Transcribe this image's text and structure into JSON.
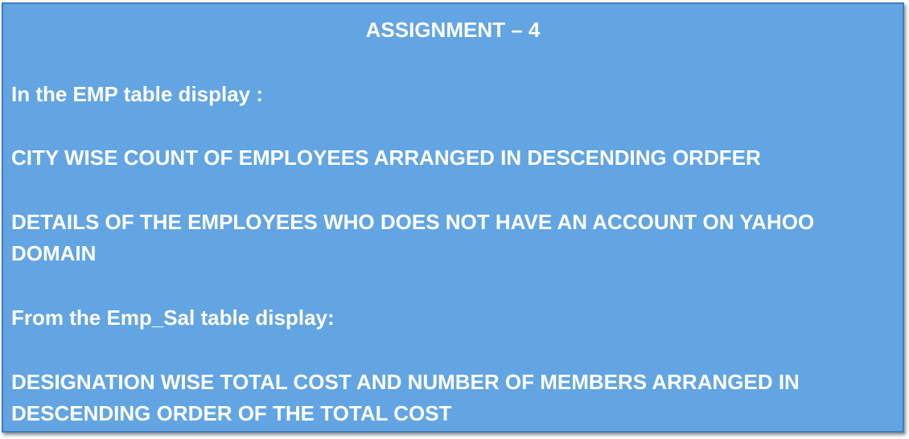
{
  "slide": {
    "title": "ASSIGNMENT – 4",
    "emp_heading": "In the EMP table display  :",
    "task_city": "CITY WISE COUNT OF EMPLOYEES ARRANGED IN DESCENDING ORDFER",
    "task_yahoo": "DETAILS OF THE EMPLOYEES WHO DOES NOT HAVE AN ACCOUNT ON YAHOO DOMAIN",
    "empsal_heading": "From the Emp_Sal table display:",
    "task_designation": "DESIGNATION WISE TOTAL COST AND NUMBER OF MEMBERS ARRANGED IN DESCENDING ORDER OF THE TOTAL COST"
  },
  "colors": {
    "box_fill": "#62a5e2",
    "box_border": "#3f7cc0",
    "text": "#ffffff"
  }
}
